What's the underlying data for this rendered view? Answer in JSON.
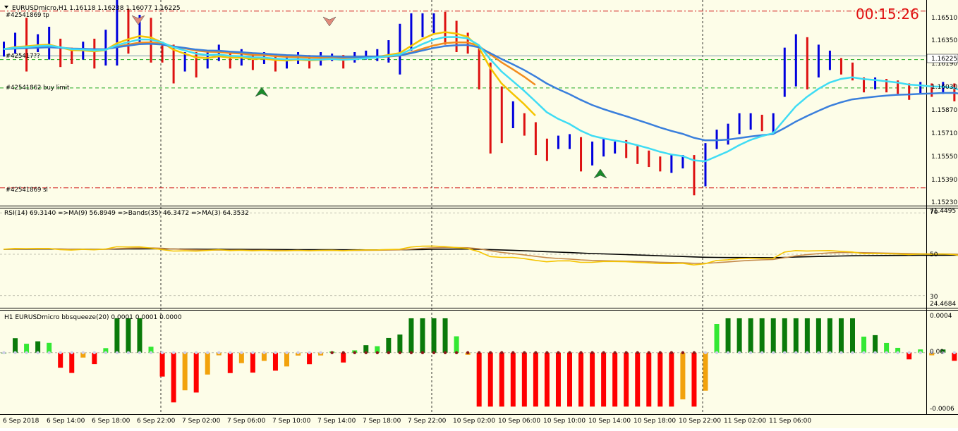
{
  "colors": {
    "background": "#fdfde8",
    "bull_bar": "#0000dd",
    "bear_bar": "#dd1111",
    "ma_orange": "#f28c1e",
    "ma_yellow": "#f5c400",
    "ma_cyan": "#3fdcf4",
    "ma_blue": "#3a7fdc",
    "rsi_yellow": "#f5c400",
    "rsi_brown": "#c58a4a",
    "rsi_black": "#000000",
    "hist_dark_green": "#0a7a0a",
    "hist_light_green": "#33e833",
    "hist_red": "#ff0000",
    "hist_orange": "#f2a20c",
    "level_red": "#d01010",
    "level_green": "#22aa22",
    "timer": "#e01010"
  },
  "main": {
    "header_text": "EURUSDmicro,H1  1.16118 1.16238 1.16077 1.16225",
    "timer": "00:15:26",
    "price_badge": "1.16225",
    "order_labels": {
      "tp": "#42541869 tp",
      "mid": "#425417??",
      "buy_limit": "#42541862 buy limit",
      "sl": "#42541869 sl"
    },
    "price_axis": [
      "1.16510",
      "1.16350",
      "1.16190",
      "1.16030",
      "1.15870",
      "1.15710",
      "1.15550",
      "1.15390",
      "1.15230"
    ],
    "icons": [
      "sell-arrow-icon",
      "sell-arrow-icon",
      "buy-arrow-icon",
      "buy-arrow-icon"
    ]
  },
  "rsi": {
    "header_text": "RSI(14) 69.3140  =>MA(9) 56.8949  =>Bands(35) 46.3472  =>MA(3) 64.3532",
    "axis": [
      "71.4495",
      "70",
      "50",
      "30",
      "24.4684"
    ]
  },
  "squeeze": {
    "header_text": "H1 EURUSDmicro bbsqueeze(20) 0.0001 0.0001 0.0000",
    "axis": [
      "0.0004",
      "0.00",
      "-0.0006"
    ]
  },
  "time_axis": [
    "6 Sep 2018",
    "6 Sep 14:00",
    "6 Sep 18:00",
    "6 Sep 22:00",
    "7 Sep 02:00",
    "7 Sep 06:00",
    "7 Sep 10:00",
    "7 Sep 14:00",
    "7 Sep 18:00",
    "7 Sep 22:00",
    "10 Sep 02:00",
    "10 Sep 06:00",
    "10 Sep 10:00",
    "10 Sep 14:00",
    "10 Sep 18:00",
    "10 Sep 22:00",
    "11 Sep 02:00",
    "11 Sep 06:00"
  ],
  "chart_data": [
    {
      "type": "line",
      "title": "EURUSDmicro,H1",
      "ohlc": {
        "open": 1.16118,
        "high": 1.16238,
        "low": 1.16077,
        "close": 1.16225
      },
      "ylim": [
        1.1523,
        1.1659
      ],
      "levels": [
        {
          "name": "tp",
          "value": 1.16525
        },
        {
          "name": "buy limit",
          "value": 1.1601
        },
        {
          "name": "sl",
          "value": 1.1534
        },
        {
          "name": "price",
          "value": 1.16225
        }
      ],
      "candles": [
        [
          1.1622,
          1.1632
        ],
        [
          1.1624,
          1.1638
        ],
        [
          1.1612,
          1.1648
        ],
        [
          1.1625,
          1.1637
        ],
        [
          1.162,
          1.1642
        ],
        [
          1.1615,
          1.1634
        ],
        [
          1.1617,
          1.1628
        ],
        [
          1.162,
          1.1632
        ],
        [
          1.1614,
          1.1634
        ],
        [
          1.1616,
          1.164
        ],
        [
          1.1616,
          1.1664
        ],
        [
          1.1624,
          1.1654
        ],
        [
          1.163,
          1.165
        ],
        [
          1.1618,
          1.1648
        ],
        [
          1.1618,
          1.1632
        ],
        [
          1.1604,
          1.163
        ],
        [
          1.1612,
          1.1625
        ],
        [
          1.1608,
          1.1625
        ],
        [
          1.1614,
          1.1626
        ],
        [
          1.1619,
          1.163
        ],
        [
          1.1614,
          1.1625
        ],
        [
          1.1616,
          1.1627
        ],
        [
          1.1613,
          1.1624
        ],
        [
          1.1617,
          1.1625
        ],
        [
          1.1612,
          1.1624
        ],
        [
          1.1614,
          1.1623
        ],
        [
          1.1617,
          1.1625
        ],
        [
          1.1614,
          1.1623
        ],
        [
          1.1616,
          1.1625
        ],
        [
          1.1619,
          1.1624
        ],
        [
          1.1614,
          1.1623
        ],
        [
          1.1618,
          1.1625
        ],
        [
          1.162,
          1.1626
        ],
        [
          1.1619,
          1.1627
        ],
        [
          1.1618,
          1.1633
        ],
        [
          1.161,
          1.1644
        ],
        [
          1.1626,
          1.1651
        ],
        [
          1.1635,
          1.1651
        ],
        [
          1.1637,
          1.1651
        ],
        [
          1.163,
          1.1652
        ],
        [
          1.1625,
          1.1646
        ],
        [
          1.1624,
          1.1638
        ],
        [
          1.16,
          1.1628
        ],
        [
          1.1557,
          1.1618
        ],
        [
          1.1564,
          1.1602
        ],
        [
          1.1574,
          1.1592
        ],
        [
          1.1569,
          1.1584
        ],
        [
          1.1556,
          1.1578
        ],
        [
          1.1552,
          1.1567
        ],
        [
          1.156,
          1.1569
        ],
        [
          1.156,
          1.157
        ],
        [
          1.1545,
          1.1568
        ],
        [
          1.1549,
          1.1565
        ],
        [
          1.1555,
          1.1567
        ],
        [
          1.1557,
          1.1565
        ],
        [
          1.1554,
          1.1566
        ],
        [
          1.155,
          1.1562
        ],
        [
          1.1548,
          1.1559
        ],
        [
          1.1545,
          1.1555
        ],
        [
          1.1544,
          1.1556
        ],
        [
          1.1547,
          1.1556
        ],
        [
          1.1529,
          1.1556
        ],
        [
          1.1535,
          1.1564
        ],
        [
          1.156,
          1.1573
        ],
        [
          1.1563,
          1.1577
        ],
        [
          1.157,
          1.1584
        ],
        [
          1.1573,
          1.1584
        ],
        [
          1.1572,
          1.1583
        ],
        [
          1.1571,
          1.1584
        ],
        [
          1.1595,
          1.1628
        ],
        [
          1.1602,
          1.1637
        ],
        [
          1.16,
          1.1635
        ],
        [
          1.1608,
          1.163
        ],
        [
          1.1613,
          1.1626
        ],
        [
          1.161,
          1.1621
        ],
        [
          1.1606,
          1.1618
        ],
        [
          1.1598,
          1.1608
        ],
        [
          1.16,
          1.1608
        ],
        [
          1.1598,
          1.1607
        ],
        [
          1.1597,
          1.1606
        ],
        [
          1.1593,
          1.1604
        ],
        [
          1.1597,
          1.1605
        ],
        [
          1.1595,
          1.1604
        ],
        [
          1.1597,
          1.1605
        ],
        [
          1.1592,
          1.1604
        ],
        [
          1.1576,
          1.16
        ],
        [
          1.1584,
          1.1596
        ],
        [
          1.159,
          1.1599
        ],
        [
          1.159,
          1.1608
        ],
        [
          1.16,
          1.1613
        ],
        [
          1.1603,
          1.1628
        ],
        [
          1.161,
          1.1644
        ]
      ]
    },
    {
      "type": "line",
      "title": "RSI(14)",
      "ylim": [
        24.4684,
        71.4495
      ],
      "series": [
        {
          "name": "RSI(14)",
          "value_label": "69.3140"
        },
        {
          "name": "MA(9)",
          "value_label": "56.8949"
        },
        {
          "name": "Bands(35)",
          "value_label": "46.3472"
        },
        {
          "name": "MA(3)",
          "value_label": "64.3532"
        }
      ]
    },
    {
      "type": "bar",
      "title": "H1 EURUSDmicro bbsqueeze(20)",
      "ylim": [
        -0.0006,
        0.0004
      ],
      "values_label": [
        "0.0001",
        "0.0001",
        "0.0000"
      ]
    }
  ]
}
